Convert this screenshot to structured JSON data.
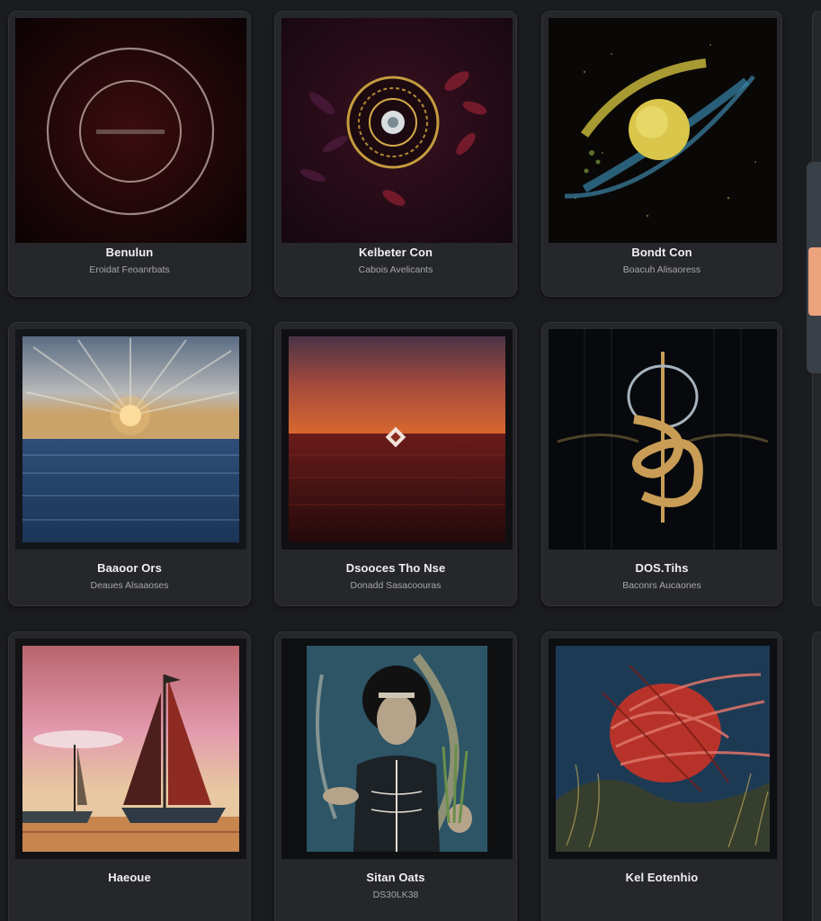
{
  "gallery": {
    "cards": [
      {
        "title": "Benulun",
        "subtitle": "Eroidat Feoanrbats",
        "art": "concentric-rings-dark-red"
      },
      {
        "title": "Kelbeter Con",
        "subtitle": "Cabois Avelicants",
        "art": "mandala-purple-floral"
      },
      {
        "title": "Bondt Con",
        "subtitle": "Boacuh Alisaoress",
        "art": "golden-planet-orbit"
      },
      {
        "title": "Baaoor Ors",
        "subtitle": "Deaues Alsaaoses",
        "art": "ocean-sunset-rays"
      },
      {
        "title": "Dsooces Tho Nse",
        "subtitle": "Donadd Sasacoouras",
        "art": "red-sea-horizon-diamond"
      },
      {
        "title": "DOS.Tihs",
        "subtitle": "Baconrs Aucaones",
        "art": "gold-serpent-symbol"
      },
      {
        "title": "Haeoue",
        "subtitle": "",
        "art": "sailboats-pink-sky"
      },
      {
        "title": "Sitan Oats",
        "subtitle": "DS30LK38",
        "art": "warrior-portrait"
      },
      {
        "title": "Kel Eotenhio",
        "subtitle": "",
        "art": "red-swirl-storm"
      }
    ]
  },
  "scrollbar": {
    "accent": "#eca27c",
    "track": "#3a4048"
  },
  "colors": {
    "background": "#1b1c1f",
    "card": "#26272b"
  }
}
